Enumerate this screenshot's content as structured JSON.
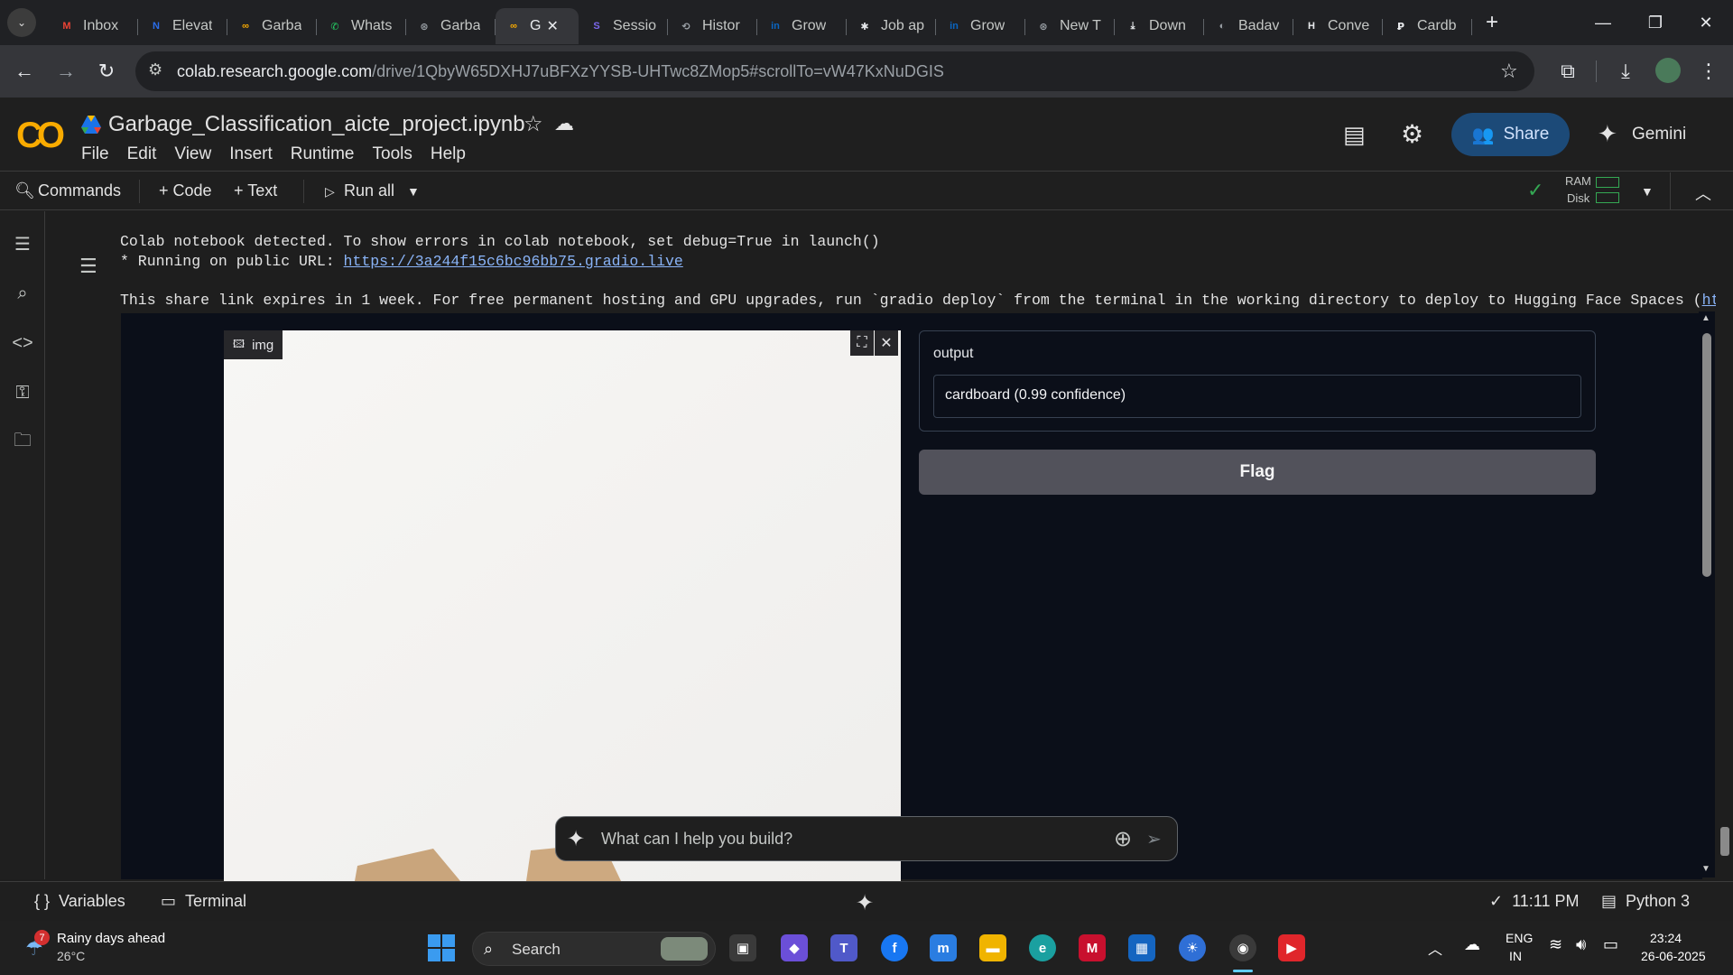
{
  "browser": {
    "tabs": [
      {
        "title": "Inbox",
        "icon": "gmail-icon",
        "color": "#ea4335",
        "glyph": "M"
      },
      {
        "title": "Elevat",
        "icon": "elevate-icon",
        "color": "#2b6de8",
        "glyph": "N"
      },
      {
        "title": "Garba",
        "icon": "colab-icon",
        "color": "#f9ab00",
        "glyph": "∞"
      },
      {
        "title": "Whats",
        "icon": "whatsapp-icon",
        "color": "#25d366",
        "glyph": "✆"
      },
      {
        "title": "Garba",
        "icon": "chatgpt-icon",
        "color": "#9aa0a6",
        "glyph": "⊛"
      },
      {
        "title": "G",
        "icon": "colab-icon",
        "color": "#f9ab00",
        "glyph": "∞",
        "active": true,
        "close": "✕"
      },
      {
        "title": "Sessio",
        "icon": "session-icon",
        "color": "#7b68ee",
        "glyph": "S"
      },
      {
        "title": "Histor",
        "icon": "history-icon",
        "color": "#9aa0a6",
        "glyph": "⟲"
      },
      {
        "title": "Grow",
        "icon": "linkedin-icon",
        "color": "#0a66c2",
        "glyph": "in"
      },
      {
        "title": "Job ap",
        "icon": "asterisk-icon",
        "color": "#e8eaed",
        "glyph": "✱"
      },
      {
        "title": "Grow",
        "icon": "linkedin-icon",
        "color": "#0a66c2",
        "glyph": "in"
      },
      {
        "title": "New T",
        "icon": "chatgpt-icon",
        "color": "#9aa0a6",
        "glyph": "⊛"
      },
      {
        "title": "Down",
        "icon": "download-icon",
        "color": "#e8eaed",
        "glyph": "⤓"
      },
      {
        "title": "Badav",
        "icon": "badav-icon",
        "color": "#9aa0a6",
        "glyph": "◐"
      },
      {
        "title": "Conve",
        "icon": "h-icon",
        "color": "#e8eaed",
        "glyph": "H"
      },
      {
        "title": "Cardb",
        "icon": "perplexity-icon",
        "color": "#e8eaed",
        "glyph": "Ꝑ"
      }
    ],
    "new_tab": "+",
    "url_host": "colab.research.google.com",
    "url_path": "/drive/1QbyW65DXHJ7uBFXzYYSB-UHTwc8ZMop5#scrollTo=vW47KxNuDGIS"
  },
  "colab": {
    "notebook_title": "Garbage_Classification_aicte_project.ipynb",
    "menu": [
      "File",
      "Edit",
      "View",
      "Insert",
      "Runtime",
      "Tools",
      "Help"
    ],
    "share_label": "Share",
    "gemini_label": "Gemini",
    "commands_label": "Commands",
    "code_label": "+ Code",
    "text_label": "+ Text",
    "run_all_label": "Run all",
    "ram_label": "RAM",
    "disk_label": "Disk"
  },
  "output": {
    "line1": "Colab notebook detected. To show errors in colab notebook, set debug=True in launch()",
    "line2_prefix": "* Running on public URL: ",
    "line2_link": "https://3a244f15c6bc96bb75.gradio.live",
    "line3_text": "This share link expires in 1 week. For free permanent hosting and GPU upgrades, run `gradio deploy` from the terminal in the working directory to deploy to Hugging Face Spaces (",
    "line3_link": "https:/"
  },
  "gradio": {
    "image_label": "img",
    "output_label": "output",
    "output_value": "cardboard (0.99 confidence)",
    "flag_label": "Flag"
  },
  "gemini_prompt": {
    "placeholder": "What can I help you build?"
  },
  "statusbar": {
    "variables_label": "Variables",
    "terminal_label": "Terminal",
    "exec_time": "11:11 PM",
    "runtime_label": "Python 3"
  },
  "taskbar": {
    "weather_badge": "7",
    "weather_title": "Rainy days ahead",
    "weather_temp": "26°C",
    "search_label": "Search",
    "lang_top": "ENG",
    "lang_bottom": "IN",
    "time": "23:24",
    "date": "26-06-2025"
  }
}
